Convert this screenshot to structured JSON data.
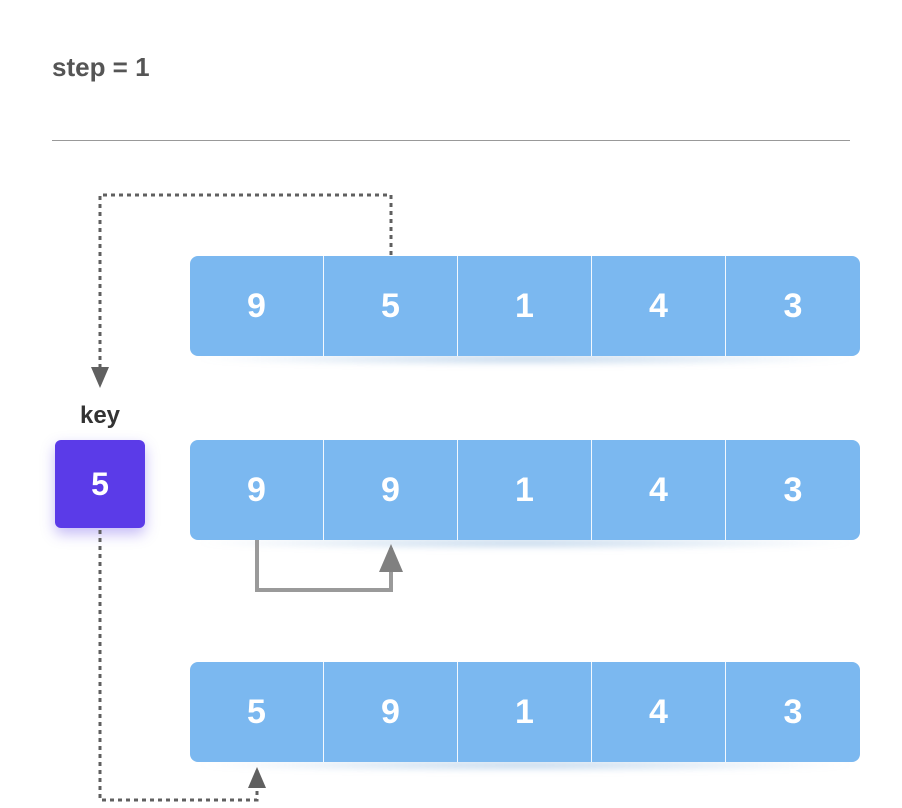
{
  "step_label": "step = 1",
  "key_label": "key",
  "key_value": "5",
  "rows": {
    "row1": [
      "9",
      "5",
      "1",
      "4",
      "3"
    ],
    "row2": [
      "9",
      "9",
      "1",
      "4",
      "3"
    ],
    "row3": [
      "5",
      "9",
      "1",
      "4",
      "3"
    ]
  }
}
